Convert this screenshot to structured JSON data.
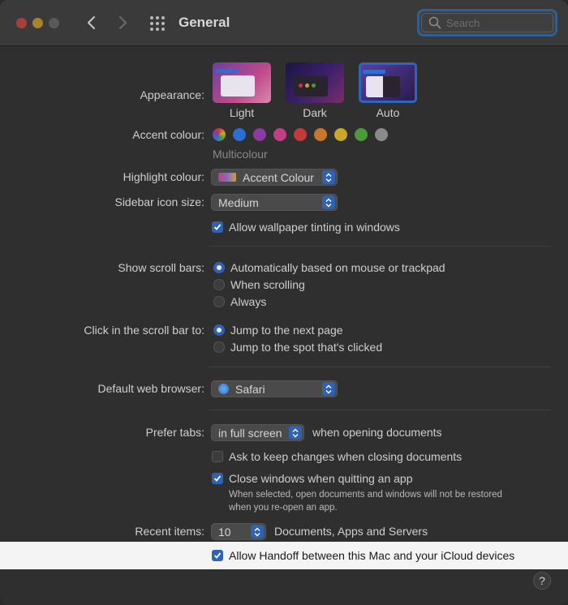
{
  "window": {
    "title": "General",
    "search_placeholder": "Search"
  },
  "appearance": {
    "label": "Appearance:",
    "options": [
      "Light",
      "Dark",
      "Auto"
    ],
    "selected": "Auto"
  },
  "accent": {
    "label": "Accent colour:",
    "selected_name": "Multicolour",
    "colors": [
      "#c0c0c0",
      "#2d6fd0",
      "#8a3aa0",
      "#c23f86",
      "#c23a3a",
      "#c8772a",
      "#c8a62a",
      "#4a9a3a",
      "#8a8a8a"
    ]
  },
  "highlight": {
    "label": "Highlight colour:",
    "value": "Accent Colour"
  },
  "sidebar_icon": {
    "label": "Sidebar icon size:",
    "value": "Medium"
  },
  "wallpaper_tint": {
    "label": "Allow wallpaper tinting in windows",
    "checked": true
  },
  "scroll_bars": {
    "label": "Show scroll bars:",
    "options": [
      "Automatically based on mouse or trackpad",
      "When scrolling",
      "Always"
    ],
    "selected": 0
  },
  "scroll_click": {
    "label": "Click in the scroll bar to:",
    "options": [
      "Jump to the next page",
      "Jump to the spot that's clicked"
    ],
    "selected": 0
  },
  "browser": {
    "label": "Default web browser:",
    "value": "Safari"
  },
  "tabs": {
    "label": "Prefer tabs:",
    "value": "in full screen",
    "suffix": "when opening documents"
  },
  "ask_keep_changes": {
    "label": "Ask to keep changes when closing documents",
    "checked": false
  },
  "close_windows": {
    "label": "Close windows when quitting an app",
    "checked": true,
    "note_line1": "When selected, open documents and windows will not be restored",
    "note_line2": "when you re-open an app."
  },
  "recent_items": {
    "label": "Recent items:",
    "value": "10",
    "suffix": "Documents, Apps and Servers"
  },
  "handoff": {
    "label": "Allow Handoff between this Mac and your iCloud devices",
    "checked": true
  },
  "help": {
    "label": "?"
  }
}
